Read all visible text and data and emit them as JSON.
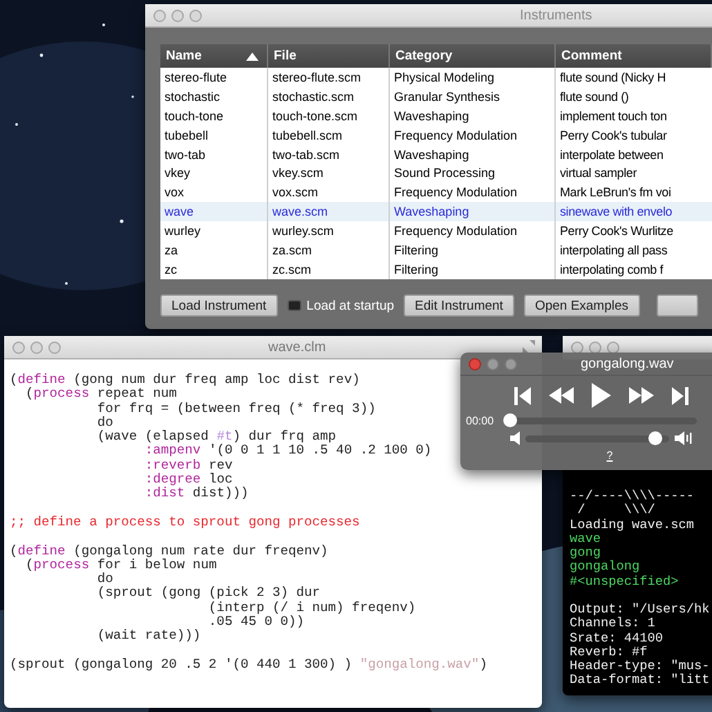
{
  "instruments_window": {
    "title": "Instruments",
    "columns": [
      {
        "label": "Name",
        "sorted": true
      },
      {
        "label": "File",
        "sorted": false
      },
      {
        "label": "Category",
        "sorted": false
      },
      {
        "label": "Comment",
        "sorted": false
      }
    ],
    "rows": [
      {
        "cells": [
          "stereo-flute",
          "stereo-flute.scm",
          "Physical Modeling",
          "flute sound (Nicky H"
        ],
        "selected": false
      },
      {
        "cells": [
          "stochastic",
          "stochastic.scm",
          "Granular Synthesis",
          "flute sound ()"
        ],
        "selected": false
      },
      {
        "cells": [
          "touch-tone",
          "touch-tone.scm",
          "Waveshaping",
          "implement touch ton"
        ],
        "selected": false
      },
      {
        "cells": [
          "tubebell",
          "tubebell.scm",
          "Frequency Modulation",
          "Perry Cook's tubular"
        ],
        "selected": false
      },
      {
        "cells": [
          "two-tab",
          "two-tab.scm",
          "Waveshaping",
          "interpolate between"
        ],
        "selected": false
      },
      {
        "cells": [
          "vkey",
          "vkey.scm",
          "Sound Processing",
          "virtual sampler"
        ],
        "selected": false
      },
      {
        "cells": [
          "vox",
          "vox.scm",
          "Frequency Modulation",
          "Mark LeBrun's fm voi"
        ],
        "selected": false
      },
      {
        "cells": [
          "wave",
          "wave.scm",
          "Waveshaping",
          "sinewave with envelo"
        ],
        "selected": true
      },
      {
        "cells": [
          "wurley",
          "wurley.scm",
          "Frequency Modulation",
          "Perry Cook's Wurlitze"
        ],
        "selected": false
      },
      {
        "cells": [
          "za",
          "za.scm",
          "Filtering",
          "interpolating all pass"
        ],
        "selected": false
      },
      {
        "cells": [
          "zc",
          "zc.scm",
          "Filtering",
          "interpolating comb f"
        ],
        "selected": false
      }
    ],
    "controls": [
      {
        "kind": "button",
        "label": "Load Instrument"
      },
      {
        "kind": "checkbox",
        "label": "Load at startup",
        "checked": false
      },
      {
        "kind": "button",
        "label": "Edit Instrument"
      },
      {
        "kind": "button",
        "label": "Open Examples"
      }
    ]
  },
  "editor_window": {
    "title": "wave.clm",
    "lines": [
      {
        "segments": [
          {
            "kind": "plain",
            "text": "("
          },
          {
            "kind": "keyword",
            "text": "define"
          },
          {
            "kind": "plain",
            "text": " (gong num dur freq amp loc dist rev)"
          }
        ]
      },
      {
        "segments": [
          {
            "kind": "plain",
            "text": "  ("
          },
          {
            "kind": "keyword",
            "text": "process"
          },
          {
            "kind": "plain",
            "text": " repeat num"
          }
        ]
      },
      {
        "segments": [
          {
            "kind": "plain",
            "text": "           for frq = (between freq (* freq 3))"
          }
        ]
      },
      {
        "segments": [
          {
            "kind": "plain",
            "text": "           do"
          }
        ]
      },
      {
        "segments": [
          {
            "kind": "plain",
            "text": "           (wave (elapsed "
          },
          {
            "kind": "constant",
            "text": "#t"
          },
          {
            "kind": "plain",
            "text": ") dur frq amp"
          }
        ]
      },
      {
        "segments": [
          {
            "kind": "keyword",
            "text": "                 :ampenv"
          },
          {
            "kind": "plain",
            "text": " '(0 0 1 1 10 .5 40 .2 100 0)"
          }
        ]
      },
      {
        "segments": [
          {
            "kind": "keyword",
            "text": "                 :reverb"
          },
          {
            "kind": "plain",
            "text": " rev"
          }
        ]
      },
      {
        "segments": [
          {
            "kind": "keyword",
            "text": "                 :degree"
          },
          {
            "kind": "plain",
            "text": " loc"
          }
        ]
      },
      {
        "segments": [
          {
            "kind": "keyword",
            "text": "                 :dist"
          },
          {
            "kind": "plain",
            "text": " dist)))"
          }
        ]
      },
      {
        "space_before": true,
        "segments": [
          {
            "kind": "comment",
            "text": ";; define a process to sprout gong processes"
          }
        ]
      },
      {
        "space_before": true,
        "segments": [
          {
            "kind": "plain",
            "text": "("
          },
          {
            "kind": "keyword",
            "text": "define"
          },
          {
            "kind": "plain",
            "text": " (gongalong num rate dur freqenv)"
          }
        ]
      },
      {
        "segments": [
          {
            "kind": "plain",
            "text": "  ("
          },
          {
            "kind": "keyword",
            "text": "process"
          },
          {
            "kind": "plain",
            "text": " for i below num"
          }
        ]
      },
      {
        "segments": [
          {
            "kind": "plain",
            "text": "           do"
          }
        ]
      },
      {
        "segments": [
          {
            "kind": "plain",
            "text": "           (sprout (gong (pick 2 3) dur"
          }
        ]
      },
      {
        "segments": [
          {
            "kind": "plain",
            "text": "                         (interp (/ i num) freqenv)"
          }
        ]
      },
      {
        "segments": [
          {
            "kind": "plain",
            "text": "                         .05 45 0 0))"
          }
        ]
      },
      {
        "segments": [
          {
            "kind": "plain",
            "text": "           (wait rate)))"
          }
        ]
      },
      {
        "space_before": true,
        "segments": [
          {
            "kind": "plain",
            "text": "(sprout (gongalong 20 .5 2 '(0 440 1 300) ) "
          },
          {
            "kind": "string",
            "text": "\"gongalong.wav\""
          },
          {
            "kind": "plain",
            "text": ")"
          }
        ]
      }
    ]
  },
  "terminal_window": {
    "lines": [
      {
        "kind": "output",
        "text": "--/----\\\\\\\\-----"
      },
      {
        "kind": "output",
        "text": " /     \\\\\\/"
      },
      {
        "kind": "output",
        "text": "Loading wave.scm"
      },
      {
        "kind": "result",
        "text": "wave"
      },
      {
        "kind": "result",
        "text": "gong"
      },
      {
        "kind": "result",
        "text": "gongalong"
      },
      {
        "kind": "result",
        "text": "#<unspecified>"
      },
      {
        "kind": "output",
        "text": "Output: \"/Users/hk",
        "space_before": true
      },
      {
        "kind": "output",
        "text": "Channels: 1"
      },
      {
        "kind": "output",
        "text": "Srate: 44100"
      },
      {
        "kind": "output",
        "text": "Reverb: #f"
      },
      {
        "kind": "output",
        "text": "Header-type: \"mus-"
      },
      {
        "kind": "output",
        "text": "Data-format: \"litt"
      }
    ]
  },
  "player_window": {
    "title": "gongalong.wav",
    "playing": false,
    "time": "00:00",
    "position": {
      "level": 0
    },
    "volume": {
      "level": 0.95
    },
    "help": "?"
  }
}
